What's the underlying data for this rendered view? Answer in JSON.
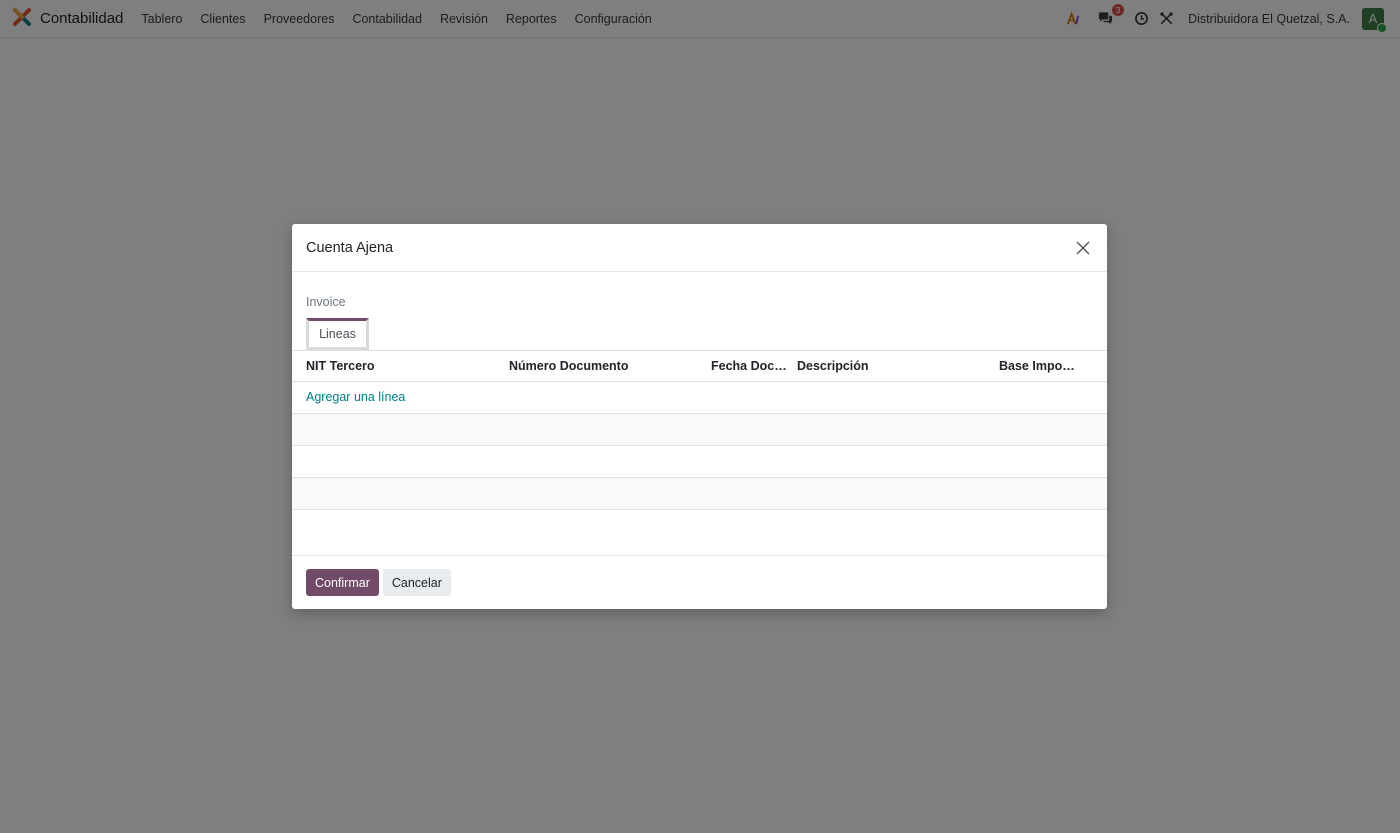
{
  "navbar": {
    "app_name": "Contabilidad",
    "menu": [
      "Tablero",
      "Clientes",
      "Proveedores",
      "Contabilidad",
      "Revisión",
      "Reportes",
      "Configuración"
    ],
    "messages_count": "3",
    "company": "Distribuidora El Quetzal, S.A.",
    "avatar_letter": "A",
    "icons": [
      "app-logo-icon",
      "ai-assistant-icon",
      "chat-bubbles-icon",
      "clock-activity-icon",
      "tools-debug-icon"
    ],
    "colors": {
      "brand": "#714b67",
      "link": "#017e84",
      "avatar": "#3f7f48",
      "badge": "#d9534f"
    }
  },
  "dialog": {
    "title": "Cuenta Ajena",
    "field_label": "Invoice",
    "tab_label": "Lineas",
    "columns": [
      "NIT Tercero",
      "Número Documento",
      "Fecha Docu...",
      "Descripción",
      "Base Imponi..."
    ],
    "add_line": "Agregar una línea",
    "confirm": "Confirmar",
    "cancel": "Cancelar"
  }
}
